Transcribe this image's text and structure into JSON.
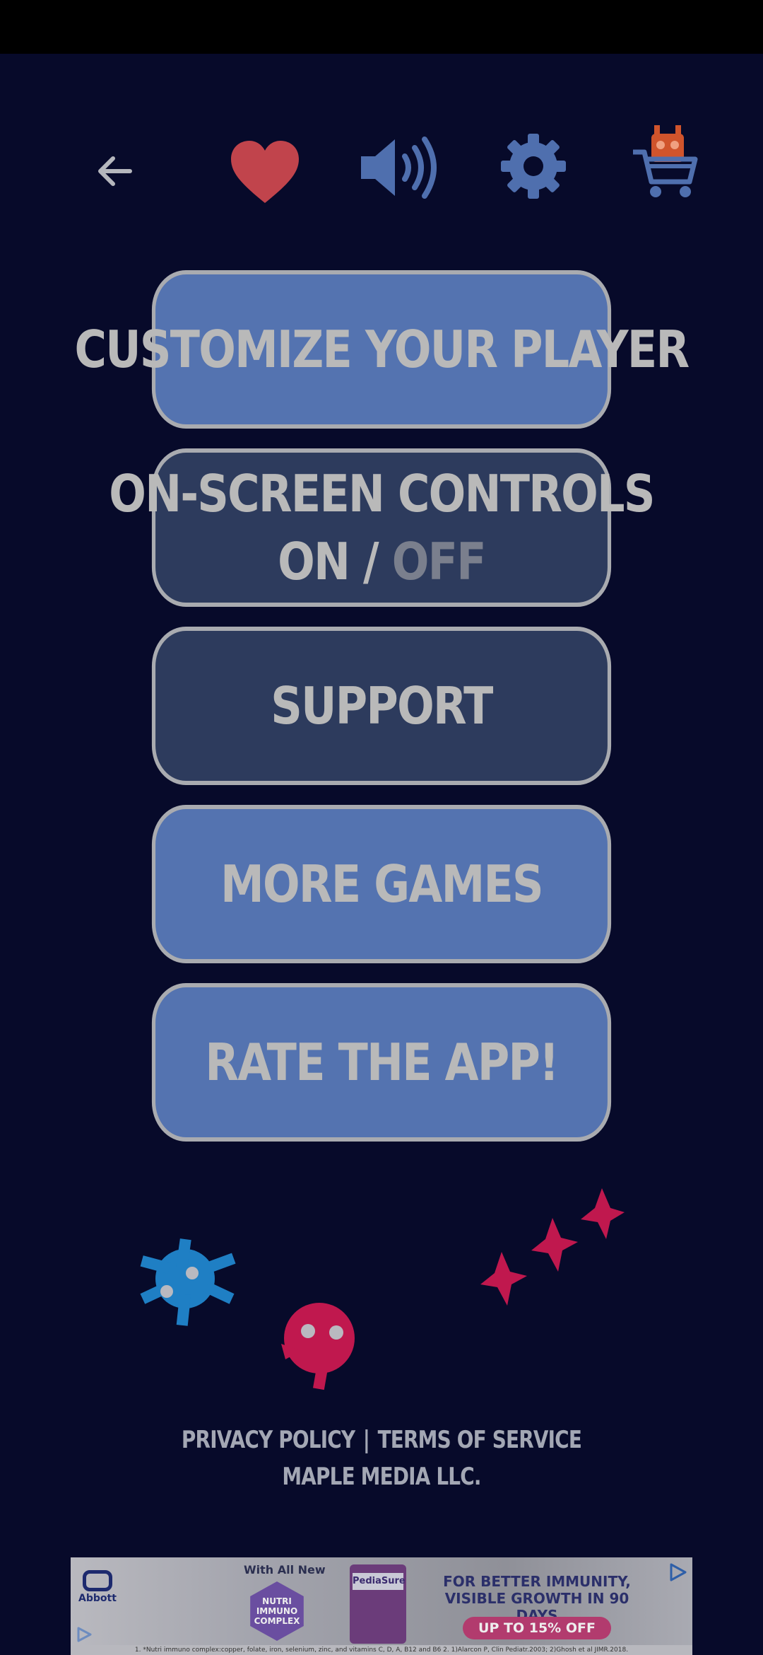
{
  "colors": {
    "background": "#070a2a",
    "button_light": "#5473b0",
    "button_dark": "#2d3b5d",
    "button_border": "#a9abb0",
    "button_text": "#b9b9b9",
    "heart": "#c1444c",
    "icon_blue": "#4f6fae",
    "shop_robot": "#d0542c"
  },
  "topbar": {
    "icons": [
      "back-arrow-icon",
      "heart-icon",
      "speaker-icon",
      "gear-icon",
      "shop-cart-icon"
    ]
  },
  "menu": {
    "customize_label": "CUSTOMIZE YOUR PLAYER",
    "controls_label": "ON-SCREEN CONTROLS",
    "controls_on": "ON",
    "controls_divider": " / ",
    "controls_off": "OFF",
    "controls_state": "ON",
    "support_label": "SUPPORT",
    "more_games_label": "MORE GAMES",
    "rate_label": "RATE THE APP!"
  },
  "footer": {
    "privacy": "PRIVACY POLICY",
    "divider": "|",
    "terms": "TERMS OF SERVICE",
    "company": "MAPLE MEDIA LLC."
  },
  "ad": {
    "brand": "Abbott",
    "with_all_new": "With All New",
    "badge_lines": [
      "NUTRI",
      "IMMUNO",
      "COMPLEX"
    ],
    "product": "PediaSure",
    "headline_1": "FOR BETTER IMMUNITY,",
    "headline_2": "VISIBLE GROWTH IN 90 DAYS",
    "cta": "UP TO 15% OFF",
    "disclaimer": "1. *Nutri immuno complex:copper, folate, iron, selenium, zinc, and vitamins C, D, A, B12 and B6 2. 1)Alarcon P, Clin Pediatr.2003; 2)Ghosh et al JIMR.2018."
  }
}
